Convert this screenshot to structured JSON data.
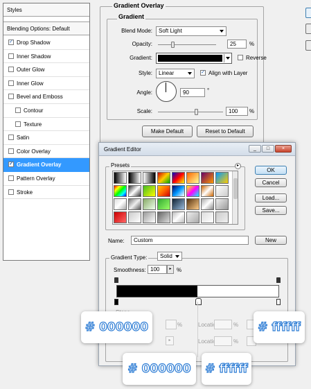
{
  "styles_panel": {
    "header": "Styles",
    "blending": "Blending Options: Default",
    "items": [
      {
        "label": "Drop Shadow",
        "checked": true,
        "indent": false,
        "selected": false
      },
      {
        "label": "Inner Shadow",
        "checked": false,
        "indent": false,
        "selected": false
      },
      {
        "label": "Outer Glow",
        "checked": false,
        "indent": false,
        "selected": false
      },
      {
        "label": "Inner Glow",
        "checked": false,
        "indent": false,
        "selected": false
      },
      {
        "label": "Bevel and Emboss",
        "checked": false,
        "indent": false,
        "selected": false
      },
      {
        "label": "Contour",
        "checked": false,
        "indent": true,
        "selected": false
      },
      {
        "label": "Texture",
        "checked": false,
        "indent": true,
        "selected": false
      },
      {
        "label": "Satin",
        "checked": false,
        "indent": false,
        "selected": false
      },
      {
        "label": "Color Overlay",
        "checked": false,
        "indent": false,
        "selected": false
      },
      {
        "label": "Gradient Overlay",
        "checked": true,
        "indent": false,
        "selected": true
      },
      {
        "label": "Pattern Overlay",
        "checked": false,
        "indent": false,
        "selected": false
      },
      {
        "label": "Stroke",
        "checked": false,
        "indent": false,
        "selected": false
      }
    ]
  },
  "gradient_overlay": {
    "outer_title": "Gradient Overlay",
    "inner_title": "Gradient",
    "blend_mode_label": "Blend Mode:",
    "blend_mode": "Soft Light",
    "opacity_label": "Opacity:",
    "opacity": "25",
    "opacity_level": 0.25,
    "percent": "%",
    "gradient_label": "Gradient:",
    "reverse_label": "Reverse",
    "reverse_checked": false,
    "style_label": "Style:",
    "style": "Linear",
    "align_label": "Align with Layer",
    "align_checked": true,
    "angle_label": "Angle:",
    "angle": "90",
    "degree": "°",
    "scale_label": "Scale:",
    "scale": "100",
    "scale_level": 0.5,
    "make_default": "Make Default",
    "reset_default": "Reset to Default"
  },
  "gradient_editor": {
    "title": "Gradient Editor",
    "presets_label": "Presets",
    "ok": "OK",
    "cancel": "Cancel",
    "load": "Load...",
    "save": "Save...",
    "name_label": "Name:",
    "name_value": "Custom",
    "new": "New",
    "type_label": "Gradient Type:",
    "type_value": "Solid",
    "smoothness_label": "Smoothness:",
    "smoothness_value": "100",
    "stops_label": "Stops",
    "location_label": "Location:",
    "percent": "%",
    "colors": {
      "start": "#000000",
      "end": "#ffffff",
      "accent": "#3399ff"
    }
  },
  "callouts": {
    "left_top": "# 000000",
    "right_top": "# ffffff",
    "left_bottom": "# 000000",
    "right_bottom": "# ffffff"
  }
}
